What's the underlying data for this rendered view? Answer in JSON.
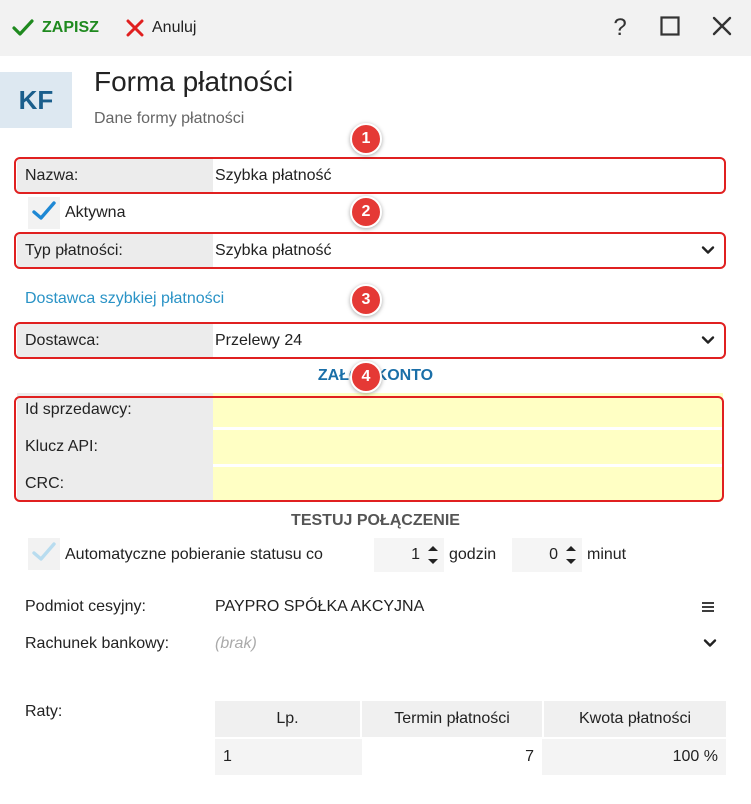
{
  "toolbar": {
    "save_label": "ZAPISZ",
    "cancel_label": "Anuluj",
    "help_label": "?"
  },
  "header": {
    "badge": "KF",
    "title": "Forma płatności",
    "subtitle": "Dane formy płatności"
  },
  "annotations": [
    "1",
    "2",
    "3",
    "4"
  ],
  "form": {
    "name_label": "Nazwa:",
    "name_value": "Szybka płatność",
    "active_label": "Aktywna",
    "payment_type_label": "Typ płatności:",
    "payment_type_value": "Szybka płatność",
    "provider_section": "Dostawca szybkiej płatności",
    "provider_label": "Dostawca:",
    "provider_value": "Przelewy 24",
    "create_account": "ZAŁÓŻ KONTO",
    "seller_id_label": "Id sprzedawcy:",
    "seller_id_value": "",
    "api_key_label": "Klucz API:",
    "api_key_value": "",
    "crc_label": "CRC:",
    "crc_value": "",
    "test_connection": "TESTUJ POŁĄCZENIE",
    "auto_status_label": "Automatyczne pobieranie statusu co",
    "hours_value": "1",
    "hours_label": "godzin",
    "minutes_value": "0",
    "minutes_label": "minut",
    "assignee_label": "Podmiot cesyjny:",
    "assignee_value": "PAYPRO SPÓŁKA AKCYJNA",
    "bank_account_label": "Rachunek bankowy:",
    "bank_account_placeholder": "(brak)",
    "installments_label": "Raty:"
  },
  "installments": {
    "headers": [
      "Lp.",
      "Termin płatności",
      "Kwota płatności"
    ],
    "rows": [
      {
        "lp": "1",
        "term": "7",
        "amount": "100 %"
      }
    ]
  },
  "colors": {
    "save_green": "#1f8a1f",
    "cancel_red": "#e02020",
    "annotation_red": "#e53935",
    "link_blue": "#2a93c6",
    "bold_link_blue": "#1a6fa8",
    "required_yellow": "#ffffc4"
  }
}
